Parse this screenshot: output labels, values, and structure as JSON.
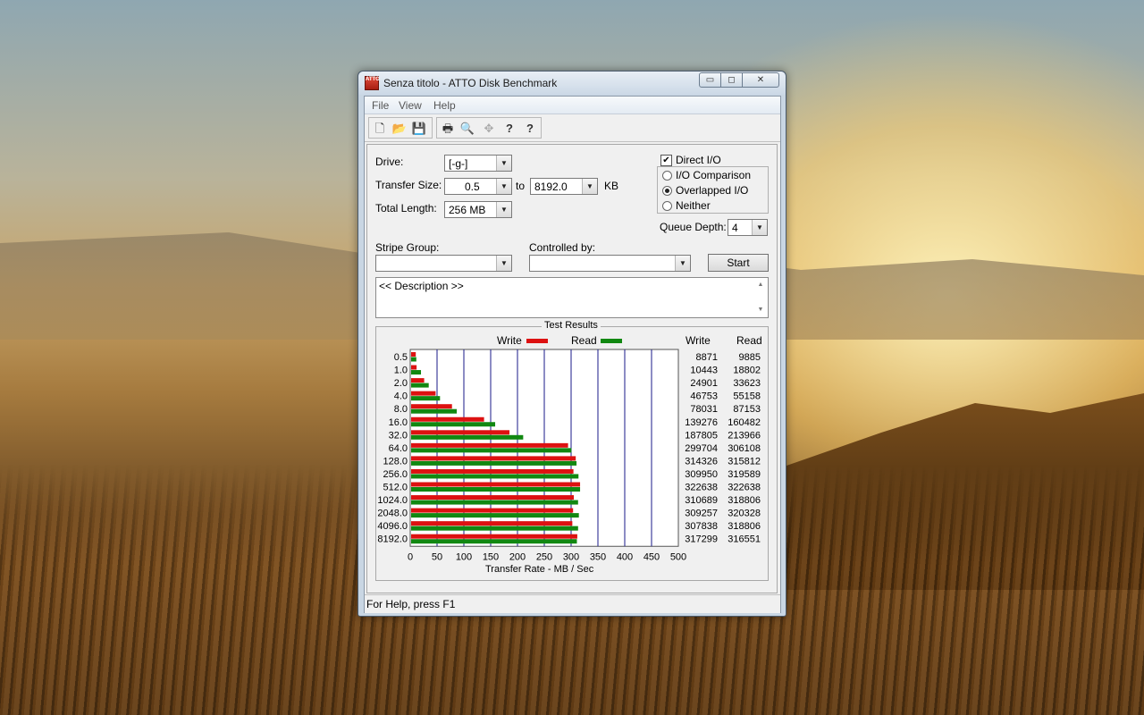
{
  "window": {
    "title": "Senza titolo - ATTO Disk Benchmark",
    "icon_name": "atto-app-icon",
    "icon_text": "ATTO",
    "min_symbol": "▭",
    "max_symbol": "◻",
    "close_symbol": "✕"
  },
  "menu": [
    "File",
    "View",
    "Help"
  ],
  "toolbar": {
    "icons": [
      "new-file-icon",
      "open-folder-icon",
      "save-icon",
      "print-icon",
      "print-preview-icon",
      "move-icon",
      "help-icon",
      "context-help-icon"
    ],
    "glyphs": [
      "🗋",
      "📂",
      "💾",
      "🖶",
      "🔍",
      "✥",
      "?",
      "?"
    ]
  },
  "form": {
    "drive_label": "Drive:",
    "drive_value": "[-g-]",
    "transfer_size_label": "Transfer Size:",
    "transfer_from": "0.5",
    "to_label": "to",
    "transfer_to": "8192.0",
    "kb_label": "KB",
    "total_length_label": "Total Length:",
    "total_length_value": "256 MB",
    "direct_io_label": "Direct I/O",
    "direct_io_checked": true,
    "io_comparison_label": "I/O Comparison",
    "overlapped_io_label": "Overlapped I/O",
    "neither_label": "Neither",
    "selected_mode": "Overlapped I/O",
    "queue_depth_label": "Queue Depth:",
    "queue_depth_value": "4",
    "stripe_group_label": "Stripe Group:",
    "stripe_group_value": "",
    "controlled_by_label": "Controlled by:",
    "controlled_by_value": "",
    "start_label": "Start",
    "description_text": "<< Description >>"
  },
  "results": {
    "title": "Test Results",
    "legend_write": "Write",
    "legend_read": "Read",
    "col_write": "Write",
    "col_read": "Read",
    "write_color": "#dd1111",
    "read_color": "#118811",
    "x_label": "Transfer Rate - MB / Sec"
  },
  "chart_data": {
    "type": "bar",
    "orientation": "horizontal",
    "categories": [
      "0.5",
      "1.0",
      "2.0",
      "4.0",
      "8.0",
      "16.0",
      "32.0",
      "64.0",
      "128.0",
      "256.0",
      "512.0",
      "1024.0",
      "2048.0",
      "4096.0",
      "8192.0"
    ],
    "series": [
      {
        "name": "Write",
        "values": [
          8871,
          10443,
          24901,
          46753,
          78031,
          139276,
          187805,
          299704,
          314326,
          309950,
          322638,
          310689,
          309257,
          307838,
          317299
        ]
      },
      {
        "name": "Read",
        "values": [
          9885,
          18802,
          33623,
          55158,
          87153,
          160482,
          213966,
          306108,
          315812,
          319589,
          322638,
          318806,
          320328,
          318806,
          316551
        ]
      }
    ],
    "xticks": [
      "0",
      "50",
      "100",
      "150",
      "200",
      "250",
      "300",
      "350",
      "400",
      "450",
      "500"
    ],
    "xlabel": "Transfer Rate - MB / Sec",
    "xlim": [
      0,
      500
    ],
    "grid": true,
    "legend": "top"
  },
  "status": {
    "text": "For Help, press F1"
  }
}
